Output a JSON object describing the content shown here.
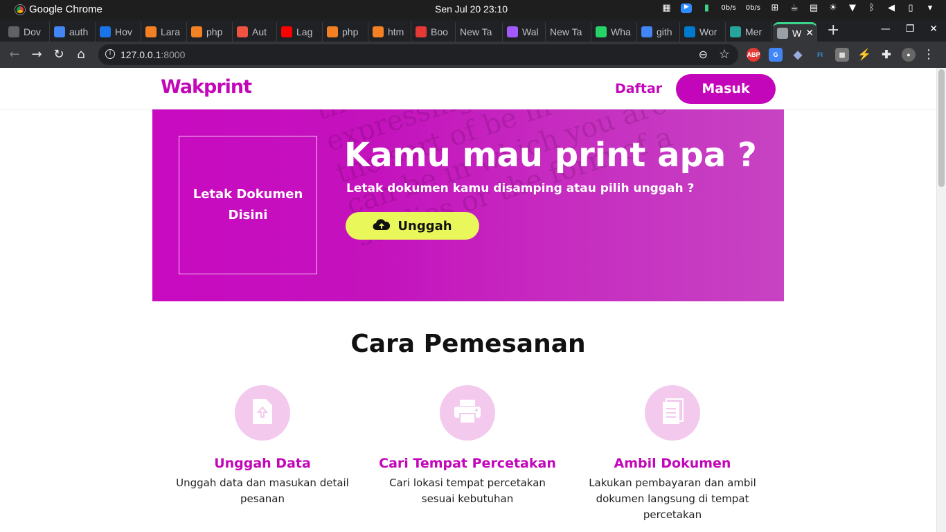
{
  "os": {
    "app_name": "Google Chrome",
    "clock": "Sen Jul 20  23:10",
    "net_down": "0b/s",
    "net_up": "0b/s"
  },
  "tabs": [
    {
      "label": "Dov",
      "icon": "download-icon",
      "color": "#5f6368"
    },
    {
      "label": "auth",
      "icon": "google-icon",
      "color": "#4285f4"
    },
    {
      "label": "Hov",
      "icon": "doc-icon",
      "color": "#1a73e8"
    },
    {
      "label": "Lara",
      "icon": "stackoverflow-icon",
      "color": "#f48024"
    },
    {
      "label": "php",
      "icon": "stackoverflow-icon",
      "color": "#f48024"
    },
    {
      "label": "Aut",
      "icon": "laravel-icon",
      "color": "#f05340"
    },
    {
      "label": "Lag",
      "icon": "youtube-icon",
      "color": "#ff0000"
    },
    {
      "label": "php",
      "icon": "stackoverflow-icon",
      "color": "#f48024"
    },
    {
      "label": "htm",
      "icon": "stackoverflow-icon",
      "color": "#f48024"
    },
    {
      "label": "Boo",
      "icon": "s-icon",
      "color": "#e53935"
    },
    {
      "label": "New Ta",
      "icon": "none",
      "color": "#202124"
    },
    {
      "label": "Wal",
      "icon": "figma-icon",
      "color": "#a259ff"
    },
    {
      "label": "New Ta",
      "icon": "none",
      "color": "#202124"
    },
    {
      "label": "Wha",
      "icon": "whatsapp-icon",
      "color": "#25d366"
    },
    {
      "label": "gith",
      "icon": "google-icon",
      "color": "#4285f4"
    },
    {
      "label": "Wor",
      "icon": "vscode-icon",
      "color": "#007acc"
    },
    {
      "label": "Mer",
      "icon": "globe-icon",
      "color": "#26a69a"
    },
    {
      "label": "W",
      "icon": "globe-icon",
      "color": "#9aa0a6",
      "active": true
    }
  ],
  "address_bar": {
    "host": "127.0.0.1",
    "port": ":8000"
  },
  "site": {
    "logo": "Wakprint",
    "nav_register": "Daftar",
    "nav_login": "Masuk",
    "brand_color": "#c306b9",
    "accent_color": "#eaf75b"
  },
  "hero": {
    "dropzone_text": "Letak Dokumen Disini",
    "title": "Kamu mau print apa ?",
    "subtitle": "Letak dokumen kamu disamping atau pilih unggah ?",
    "upload_label": "Unggah",
    "texture_lines": [
      "the Gifting gratitude. If you fake or",
      "expressing of balance. If you",
      "the sort of be in the form of a",
      "can be in which you are",
      "studies or the form of a"
    ]
  },
  "section": {
    "title": "Cara Pemesanan"
  },
  "steps": [
    {
      "icon": "file-upload-icon",
      "title": "Unggah Data",
      "desc": "Unggah data dan masukan detail pesanan"
    },
    {
      "icon": "printer-icon",
      "title": "Cari Tempat Percetakan",
      "desc": "Cari lokasi tempat percetakan sesuai kebutuhan"
    },
    {
      "icon": "document-icon",
      "title": "Ambil Dokumen",
      "desc": "Lakukan pembayaran dan ambil dokumen langsung di tempat percetakan"
    }
  ]
}
